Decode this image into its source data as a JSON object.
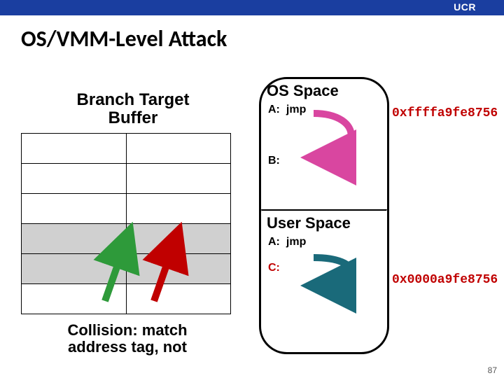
{
  "header": {
    "ucr": "UCR"
  },
  "title": "OS/VMM-Level Attack",
  "btb_label_l1": "Branch Target",
  "btb_label_l2": "Buffer",
  "collision_l1": "Collision: match",
  "collision_l2": "address tag, not",
  "space": {
    "os_header": "OS Space",
    "user_header": "User Space",
    "os_A_lbl": "A:",
    "os_A_instr": "jmp",
    "os_B_lbl": "B:",
    "user_A_lbl": "A:",
    "user_A_instr": "jmp",
    "user_C_lbl": "C:"
  },
  "addr_os": "0xffffa9fe8756",
  "addr_user": "0x0000a9fe8756",
  "slide_number": "87"
}
